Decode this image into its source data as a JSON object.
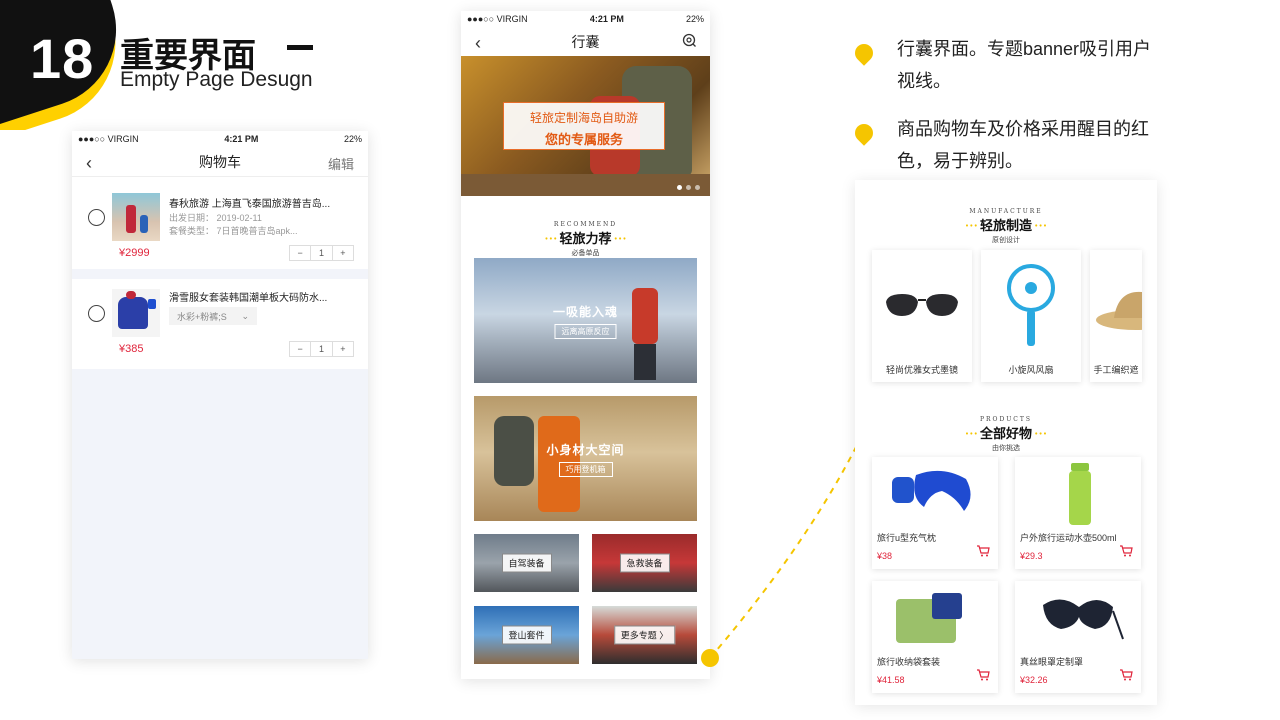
{
  "header": {
    "number": "18",
    "title": "重要界面",
    "subtitle": "Empty Page Desugn"
  },
  "cart_phone": {
    "status": {
      "carrier": "●●●○○ VIRGIN",
      "time": "4:21 PM",
      "battery": "22%"
    },
    "nav": {
      "title": "购物车",
      "right": "编辑"
    },
    "items": [
      {
        "title": "春秋旅游 上海直飞泰国旅游普吉岛...",
        "meta1": "出发日期：  2019-02-11",
        "meta2": "套餐类型：  7日首晚普吉岛apk...",
        "price": "¥2999",
        "qty": "1"
      },
      {
        "title": "滑雪服女套装韩国潮单板大码防水...",
        "spec": "水彩+粉裤;S",
        "price": "¥385",
        "qty": "1"
      }
    ],
    "stepper_minus": "−",
    "stepper_plus": "+"
  },
  "bag_phone": {
    "status": {
      "carrier": "●●●○○ VIRGIN",
      "time": "4:21 PM",
      "battery": "22%"
    },
    "nav": {
      "title": "行囊"
    },
    "banner": {
      "line1": "轻旅定制海岛自助游",
      "line2": "您的专属服务"
    },
    "recommend": {
      "en": "RECOMMEND",
      "cn": "轻旅力荐",
      "sub": "必备单品"
    },
    "feature1": {
      "big": "一吸能入魂",
      "small": "远离高原反应"
    },
    "feature2": {
      "big": "小身材大空间",
      "small": "巧用登机箱"
    },
    "tiles": [
      "自驾装备",
      "急救装备",
      "登山套件",
      "更多专题 〉"
    ]
  },
  "notes": [
    "行囊界面。专题banner吸引用户视线。",
    "商品购物车及价格采用醒目的红色，易于辨别。"
  ],
  "products_panel": {
    "manufacture": {
      "en": "MANUFACTURE",
      "cn": "轻旅制造",
      "sub": "原创设计"
    },
    "mf_items": [
      "轻尚优雅女式墨镜",
      "小旋风风扇",
      "手工编织遮"
    ],
    "all": {
      "en": "PRODUCTS",
      "cn": "全部好物",
      "sub": "由你挑选"
    },
    "products": [
      {
        "name": "旅行u型充气枕",
        "price": "¥38"
      },
      {
        "name": "户外旅行运动水壶500ml",
        "price": "¥29.3"
      },
      {
        "name": "旅行收纳袋套装",
        "price": "¥41.58"
      },
      {
        "name": "真丝眼罩定制罩",
        "price": "¥32.26"
      }
    ]
  },
  "colors": {
    "accent": "#f5c500",
    "price": "#e0243b",
    "dark": "#111111"
  }
}
